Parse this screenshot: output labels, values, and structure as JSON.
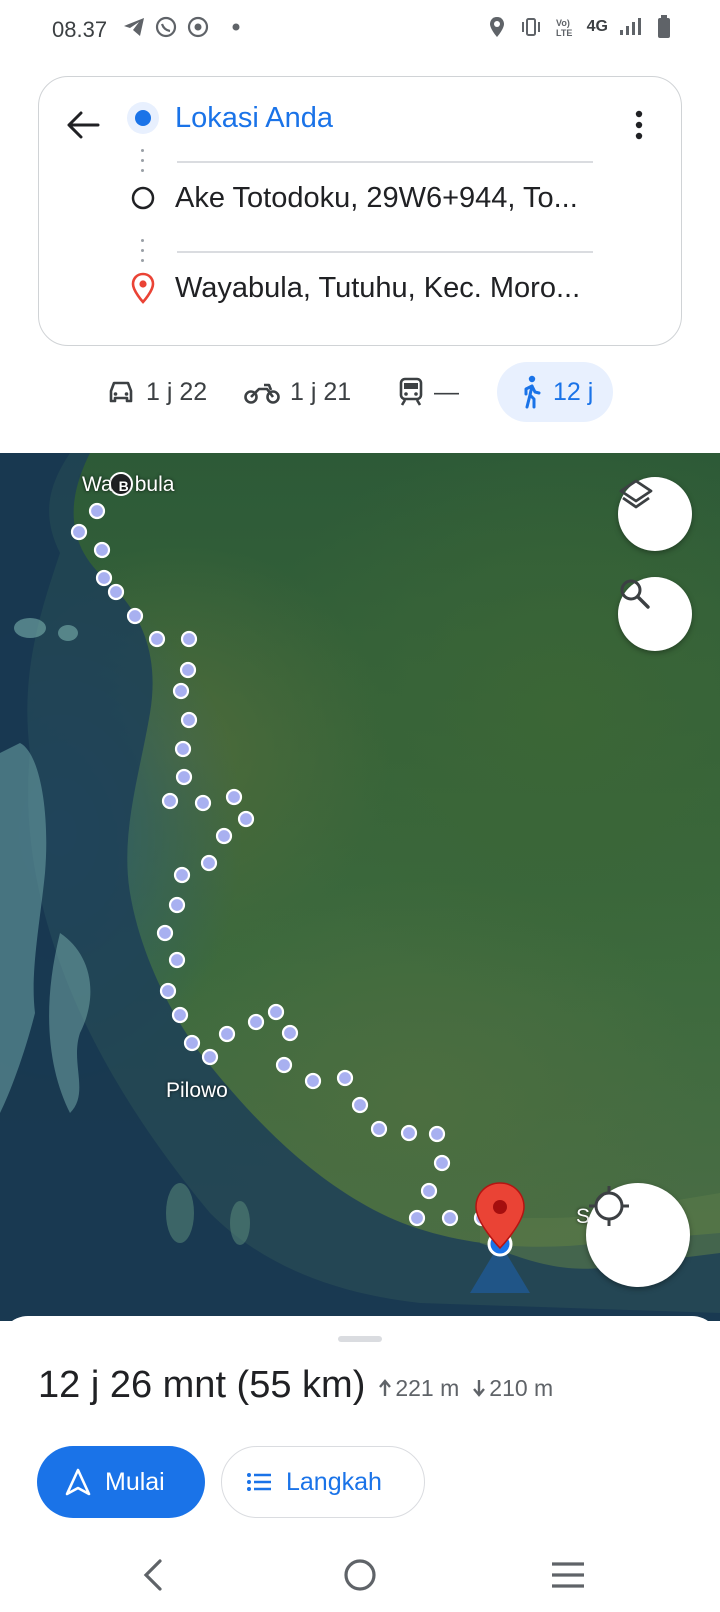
{
  "status_bar": {
    "time": "08.37",
    "network": "4G"
  },
  "directions": {
    "origin": "Lokasi Anda",
    "waypoint": "Ake Totodoku, 29W6+944, To...",
    "destination": "Wayabula, Tutuhu, Kec. Moro..."
  },
  "modes": [
    {
      "name": "car",
      "label": "1 j 22"
    },
    {
      "name": "motorcycle",
      "label": "1 j 21"
    },
    {
      "name": "transit",
      "label": "—"
    },
    {
      "name": "walk",
      "label": "12 j",
      "selected": true
    }
  ],
  "map": {
    "labels": {
      "wayabula_pre": "Wa",
      "wayabula_marker": "B",
      "wayabula_post": "bula",
      "pilowo": "Pilowo",
      "edge": "S"
    }
  },
  "summary": {
    "duration": "12 j 26 mnt (55 km)",
    "ascent": "221 m",
    "descent": "210 m"
  },
  "buttons": {
    "start": "Mulai",
    "steps": "Langkah"
  },
  "colors": {
    "accent": "#1a73e8",
    "pin": "#ea4335",
    "route_dot": "#a8b0f0"
  }
}
